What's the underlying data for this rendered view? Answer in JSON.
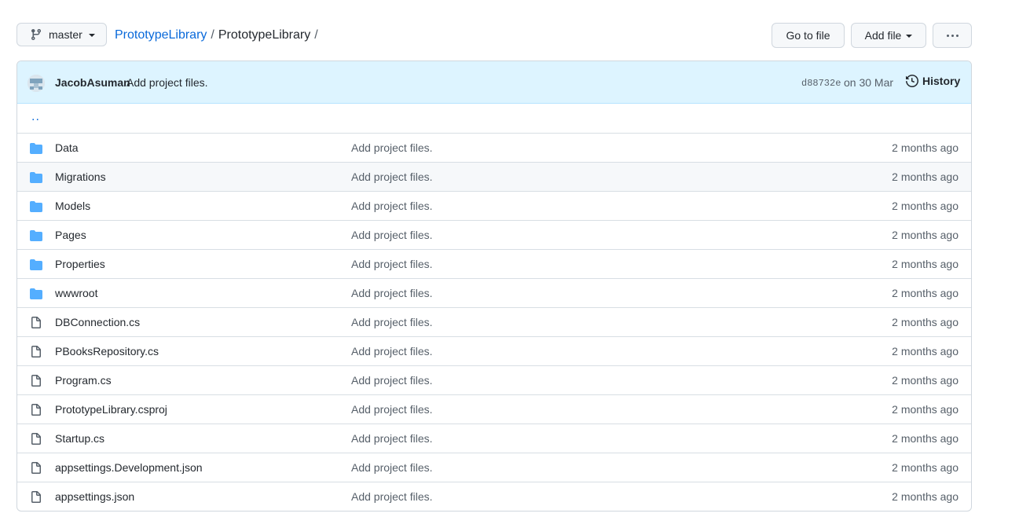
{
  "branch": {
    "label": "master"
  },
  "breadcrumb": {
    "repo": "PrototypeLibrary",
    "separator": "/",
    "folder": "PrototypeLibrary",
    "trailing": "/"
  },
  "actions": {
    "goto_label": "Go to file",
    "addfile_label": "Add file"
  },
  "commit": {
    "author": "JacobAsuman",
    "message": "Add project files.",
    "sha": "d88732e",
    "date": "on 30 Mar",
    "history_label": "History"
  },
  "parent_dir": "..",
  "files": [
    {
      "name": "Data",
      "type": "folder",
      "message": "Add project files.",
      "age": "2 months ago"
    },
    {
      "name": "Migrations",
      "type": "folder",
      "message": "Add project files.",
      "age": "2 months ago"
    },
    {
      "name": "Models",
      "type": "folder",
      "message": "Add project files.",
      "age": "2 months ago"
    },
    {
      "name": "Pages",
      "type": "folder",
      "message": "Add project files.",
      "age": "2 months ago"
    },
    {
      "name": "Properties",
      "type": "folder",
      "message": "Add project files.",
      "age": "2 months ago"
    },
    {
      "name": "wwwroot",
      "type": "folder",
      "message": "Add project files.",
      "age": "2 months ago"
    },
    {
      "name": "DBConnection.cs",
      "type": "file",
      "message": "Add project files.",
      "age": "2 months ago"
    },
    {
      "name": "PBooksRepository.cs",
      "type": "file",
      "message": "Add project files.",
      "age": "2 months ago"
    },
    {
      "name": "Program.cs",
      "type": "file",
      "message": "Add project files.",
      "age": "2 months ago"
    },
    {
      "name": "PrototypeLibrary.csproj",
      "type": "file",
      "message": "Add project files.",
      "age": "2 months ago"
    },
    {
      "name": "Startup.cs",
      "type": "file",
      "message": "Add project files.",
      "age": "2 months ago"
    },
    {
      "name": "appsettings.Development.json",
      "type": "file",
      "message": "Add project files.",
      "age": "2 months ago"
    },
    {
      "name": "appsettings.json",
      "type": "file",
      "message": "Add project files.",
      "age": "2 months ago"
    }
  ],
  "icons": {
    "branch": "git-branch-icon",
    "folder": "folder-icon",
    "file": "file-icon",
    "history": "history-icon",
    "more": "kebab-horizontal-icon"
  },
  "colors": {
    "link": "#0969da",
    "folder": "#54aeff",
    "commit_bar": "#ddf4ff"
  }
}
